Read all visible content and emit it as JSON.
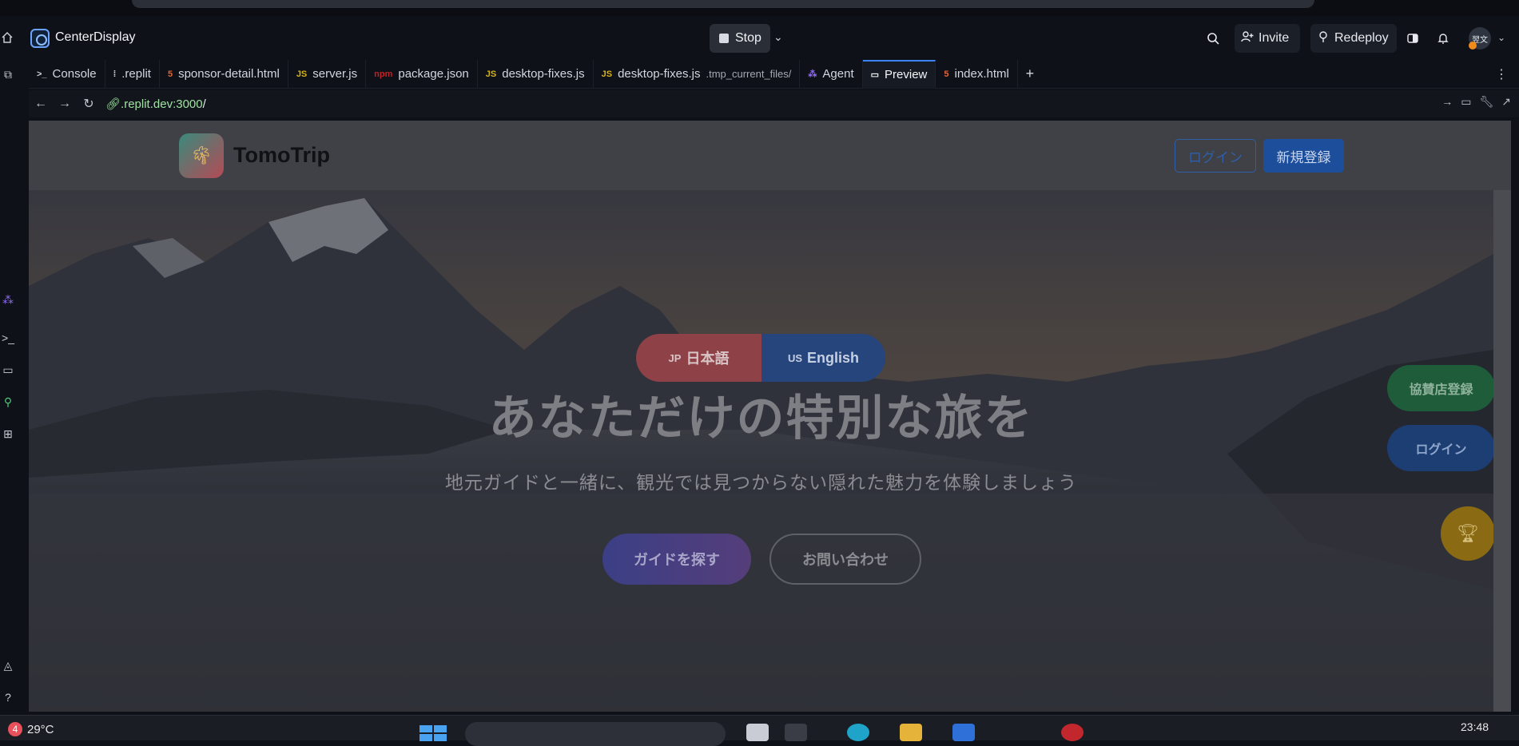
{
  "window": {
    "app_name": "CenterDisplay"
  },
  "header": {
    "stop_label": "Stop",
    "invite_label": "Invite",
    "redeploy_label": "Redeploy",
    "avatar_text": "翌文"
  },
  "tabs": [
    {
      "label": "Console",
      "icon": ">_",
      "icon_color": "#c9ccd4"
    },
    {
      "label": ".replit",
      "icon": "⁞",
      "icon_color": "#c9ccd4"
    },
    {
      "label": "sponsor-detail.html",
      "icon": "5",
      "icon_color": "#e4643a"
    },
    {
      "label": "server.js",
      "icon": "JS",
      "icon_color": "#d6b21a"
    },
    {
      "label": "package.json",
      "icon": "npm",
      "icon_color": "#c12127"
    },
    {
      "label": "desktop-fixes.js",
      "icon": "JS",
      "icon_color": "#d6b21a"
    },
    {
      "label": "desktop-fixes.js",
      "sub": ".tmp_current_files/",
      "icon": "JS",
      "icon_color": "#d6b21a"
    },
    {
      "label": "Agent",
      "icon": "⁂",
      "icon_color": "#8e6cf0"
    },
    {
      "label": "Preview",
      "icon": "▭",
      "icon_color": "#c9ccd4",
      "active": true
    },
    {
      "label": "index.html",
      "icon": "5",
      "icon_color": "#e4643a"
    }
  ],
  "urlbar": {
    "host": ".replit.dev:3000",
    "path": "/"
  },
  "site": {
    "brand": "TomoTrip",
    "login_label": "ログイン",
    "register_label": "新規登録",
    "lang_jp_code": "JP",
    "lang_jp_label": "日本語",
    "lang_en_code": "US",
    "lang_en_label": "English",
    "hero_title": "あなただけの特別な旅を",
    "hero_subtitle": "地元ガイドと一緒に、観光では見つからない隠れた魅力を体験しましょう",
    "find_guide_label": "ガイドを探す",
    "contact_label": "お問い合わせ",
    "partner_label": "協賛店登録",
    "float_login_label": "ログイン",
    "trophy_icon": "trophy-icon"
  },
  "taskbar": {
    "weather_badge": "4",
    "temperature": "29°C",
    "time": "23:48"
  },
  "colors": {
    "accent": "#3b82f6",
    "url_host": "#9fe3a0",
    "register_bg": "#1d4e9b",
    "partner_bg": "#1f5c3a"
  }
}
